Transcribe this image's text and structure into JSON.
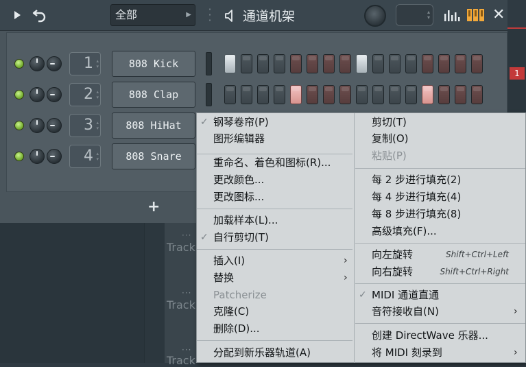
{
  "window": {
    "title": "通道机架",
    "group_value": "全部"
  },
  "icons": {
    "play": "play-icon",
    "undo": "undo-icon",
    "speaker": "speaker-icon",
    "swing_knob": "swing-knob",
    "graph": "graph-editor-icon",
    "keys": "keyboard-icon",
    "close": "close-icon",
    "add": "plus-icon"
  },
  "close_label": "✕",
  "add_label": "+",
  "channels": [
    {
      "num": "1",
      "name": "808 Kick"
    },
    {
      "num": "2",
      "name": "808 Clap"
    },
    {
      "num": "3",
      "name": "808 HiHat"
    },
    {
      "num": "4",
      "name": "808 Snare"
    }
  ],
  "steps": {
    "row1_on": [
      1,
      9
    ],
    "row2_on": [
      5,
      13
    ]
  },
  "background": {
    "track_labels": [
      "Track",
      "Track",
      "Track"
    ],
    "badge": "1"
  },
  "menu_left": [
    {
      "label": "钢琴卷帘(P)",
      "checked": true
    },
    {
      "label": "图形编辑器"
    },
    {
      "label": "重命名、着色和图标(R)..."
    },
    {
      "label": "更改颜色..."
    },
    {
      "label": "更改图标..."
    },
    {
      "label": "加载样本(L)..."
    },
    {
      "label": "自行剪切(T)",
      "checked": true
    },
    {
      "label": "插入(I)",
      "submenu": true
    },
    {
      "label": "替换",
      "submenu": true
    },
    {
      "label": "Patcherize",
      "disabled": true
    },
    {
      "label": "克隆(C)"
    },
    {
      "label": "删除(D)..."
    },
    {
      "label": "分配到新乐器轨道(A)"
    }
  ],
  "menu_right": [
    {
      "label": "剪切(T)"
    },
    {
      "label": "复制(O)"
    },
    {
      "label": "粘贴(P)",
      "disabled": true
    },
    {
      "label": "每 2 步进行填充(2)"
    },
    {
      "label": "每 4 步进行填充(4)"
    },
    {
      "label": "每 8 步进行填充(8)"
    },
    {
      "label": "高级填充(F)..."
    },
    {
      "label": "向左旋转",
      "shortcut": "Shift+Ctrl+Left"
    },
    {
      "label": "向右旋转",
      "shortcut": "Shift+Ctrl+Right"
    },
    {
      "label": "MIDI 通道直通",
      "checked": true
    },
    {
      "label": "音符接收自(N)",
      "submenu": true
    },
    {
      "label": "创建 DirectWave 乐器..."
    },
    {
      "label": "将 MIDI 刻录到",
      "submenu": true
    }
  ],
  "submenu_arrow": "›",
  "check_mark": "✓"
}
